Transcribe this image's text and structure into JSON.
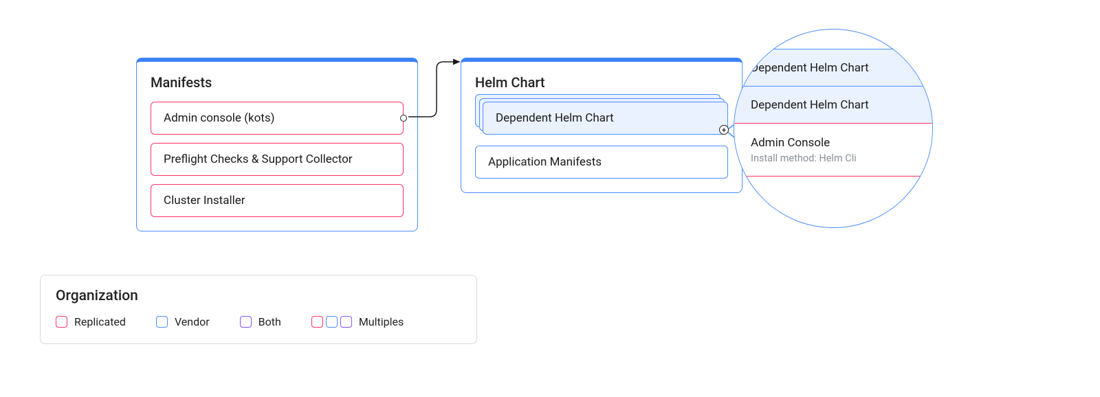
{
  "manifests": {
    "title": "Manifests",
    "items": [
      {
        "label": "Admin console (kots)"
      },
      {
        "label": "Preflight Checks & Support Collector"
      },
      {
        "label": "Cluster Installer"
      }
    ]
  },
  "helmchart": {
    "title": "Helm Chart",
    "dependent_label": "Dependent Helm Chart",
    "app_manifests_label": "Application Manifests"
  },
  "zoom": {
    "row1": "Dependent Helm Chart",
    "row2": "Dependent Helm Chart",
    "row3_title": "Admin Console",
    "row3_sub": "Install method: Helm Cli"
  },
  "legend": {
    "title": "Organization",
    "replicated": "Replicated",
    "vendor": "Vendor",
    "both": "Both",
    "multiples": "Multiples"
  },
  "colors": {
    "red": "#ff3363",
    "blue": "#4c8dff",
    "purple": "#8453ff",
    "zoom_fill": "#eaf2ff"
  }
}
